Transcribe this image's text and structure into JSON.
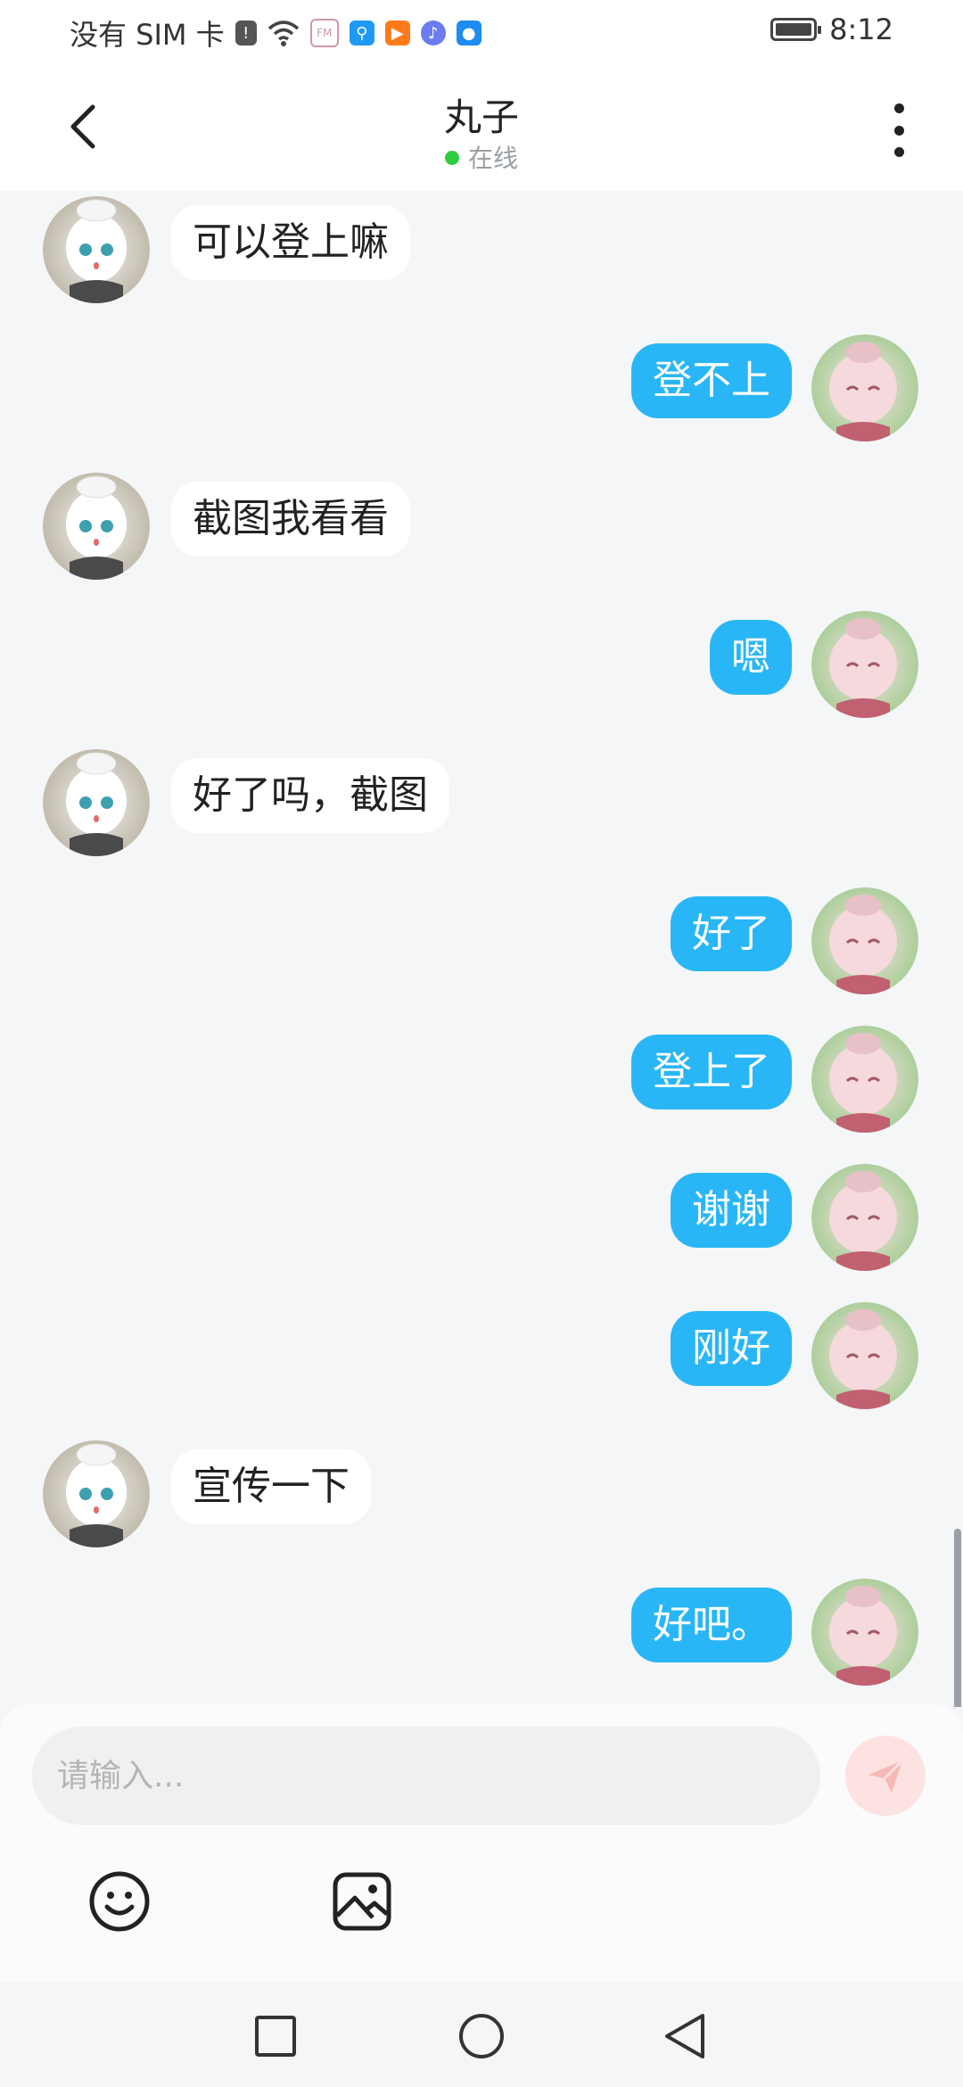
{
  "status_bar": {
    "carrier": "没有 SIM 卡",
    "time": "8:12"
  },
  "header": {
    "title": "丸子",
    "status": "在线"
  },
  "messages": [
    {
      "side": "in",
      "text": "可以登上嘛"
    },
    {
      "side": "out",
      "text": "登不上"
    },
    {
      "side": "in",
      "text": "截图我看看"
    },
    {
      "side": "out",
      "text": "嗯"
    },
    {
      "side": "in",
      "text": "好了吗，截图"
    },
    {
      "side": "out",
      "text": "好了"
    },
    {
      "side": "out",
      "text": "登上了"
    },
    {
      "side": "out",
      "text": "谢谢"
    },
    {
      "side": "out",
      "text": "刚好"
    },
    {
      "side": "in",
      "text": "宣传一下"
    },
    {
      "side": "out",
      "text": "好吧。"
    }
  ],
  "composer": {
    "placeholder": "请输入..."
  },
  "icons": {
    "back": "back-arrow-icon",
    "more": "more-vertical-icon",
    "send": "send-icon",
    "emoji": "emoji-icon",
    "image": "image-icon"
  },
  "colors": {
    "outgoing_bubble": "#29b6f6",
    "incoming_bubble": "#ffffff",
    "online_dot": "#2ecc40",
    "send_button": "#fde2e2"
  }
}
